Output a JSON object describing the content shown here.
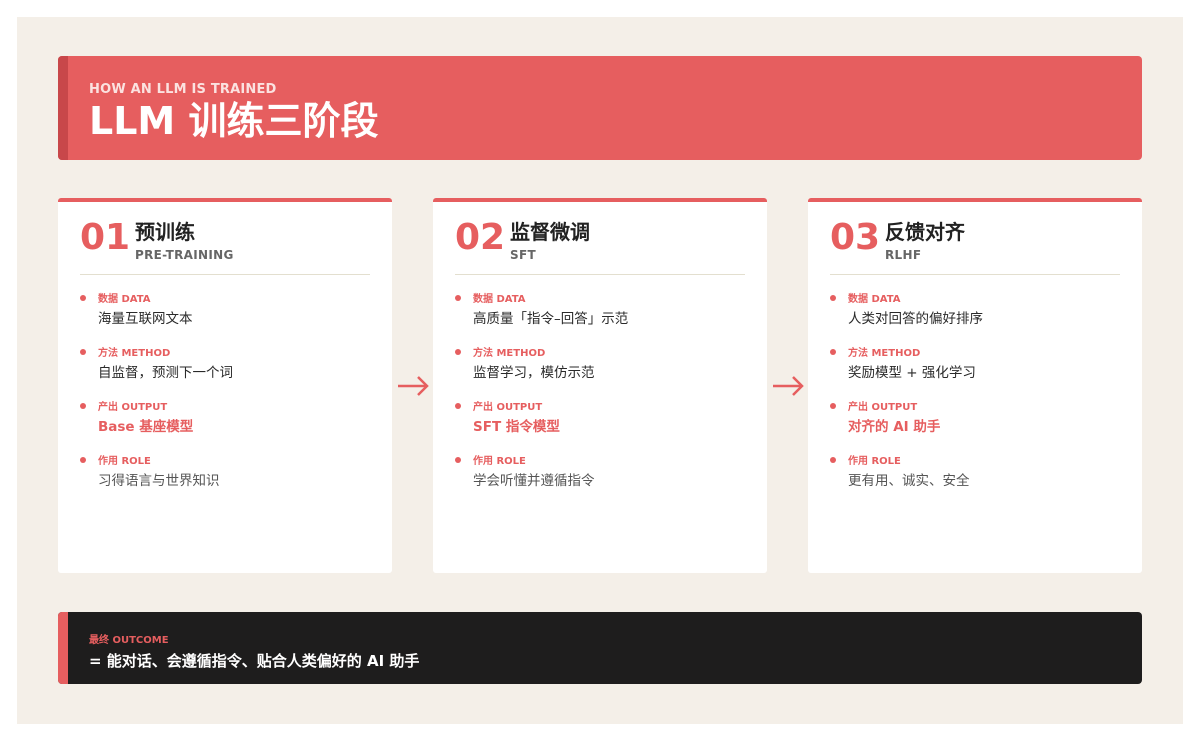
{
  "header": {
    "kicker": "HOW AN LLM IS TRAINED",
    "title": "LLM 训练三阶段"
  },
  "stages": [
    {
      "num": "01",
      "name": "预训练",
      "en": "PRE-TRAINING",
      "rows": [
        {
          "label": "数据 DATA",
          "value": "海量互联网文本"
        },
        {
          "label": "方法 METHOD",
          "value": "自监督，预测下一个词"
        },
        {
          "label": "产出 OUTPUT",
          "value": "Base 基座模型"
        },
        {
          "label": "作用 ROLE",
          "value": "习得语言与世界知识"
        }
      ]
    },
    {
      "num": "02",
      "name": "监督微调",
      "en": "SFT",
      "rows": [
        {
          "label": "数据 DATA",
          "value": "高质量「指令–回答」示范"
        },
        {
          "label": "方法 METHOD",
          "value": "监督学习，模仿示范"
        },
        {
          "label": "产出 OUTPUT",
          "value": "SFT 指令模型"
        },
        {
          "label": "作用 ROLE",
          "value": "学会听懂并遵循指令"
        }
      ]
    },
    {
      "num": "03",
      "name": "反馈对齐",
      "en": "RLHF",
      "rows": [
        {
          "label": "数据 DATA",
          "value": "人类对回答的偏好排序"
        },
        {
          "label": "方法 METHOD",
          "value": "奖励模型 + 强化学习"
        },
        {
          "label": "产出 OUTPUT",
          "value": "对齐的 AI 助手"
        },
        {
          "label": "作用 ROLE",
          "value": "更有用、诚实、安全"
        }
      ]
    }
  ],
  "outcome": {
    "label": "最终 OUTCOME",
    "text": "= 能对话、会遵循指令、贴合人类偏好的 AI 助手"
  },
  "colors": {
    "accent": "#e65e5f",
    "dark": "#1e1d1d",
    "background": "#f4efe8"
  },
  "icons": {
    "flow_arrow": "arrow-right-icon",
    "bullet": "dot-icon"
  }
}
